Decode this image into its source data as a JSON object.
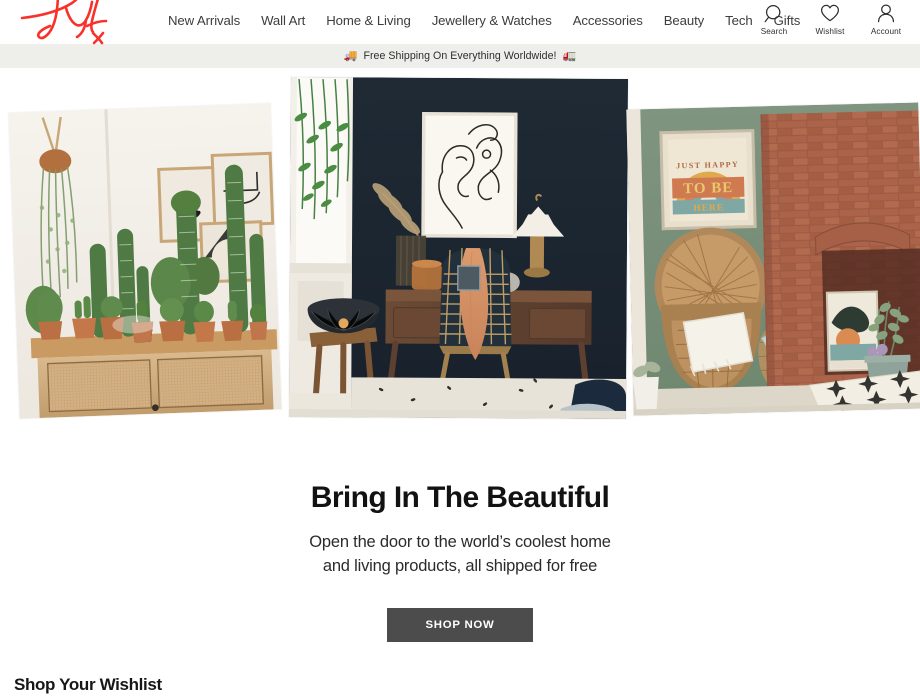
{
  "brand": {
    "logo_name": "fy-logo",
    "logo_color": "#f8312a"
  },
  "header": {
    "nav": [
      {
        "label": "New Arrivals",
        "name": "nav-new-arrivals"
      },
      {
        "label": "Wall Art",
        "name": "nav-wall-art"
      },
      {
        "label": "Home & Living",
        "name": "nav-home-living"
      },
      {
        "label": "Jewellery & Watches",
        "name": "nav-jewellery-watches"
      },
      {
        "label": "Accessories",
        "name": "nav-accessories"
      },
      {
        "label": "Beauty",
        "name": "nav-beauty"
      },
      {
        "label": "Tech",
        "name": "nav-tech"
      },
      {
        "label": "Gifts",
        "name": "nav-gifts"
      }
    ],
    "actions": [
      {
        "label": "Search",
        "icon": "search-icon"
      },
      {
        "label": "Wishlist",
        "icon": "heart-icon"
      },
      {
        "label": "Account",
        "icon": "person-icon"
      }
    ]
  },
  "announcement": {
    "left_icon": "truck-emoji",
    "text": "Free Shipping On Everything Worldwide!",
    "right_icon": "truck-emoji",
    "background": "#eeeeea"
  },
  "hero": {
    "images": [
      {
        "name": "hero-image-cactus-sideboard",
        "alt": "Cactus and succulent collection in terracotta pots on a rattan sideboard against a white wall with framed line-art prints"
      },
      {
        "name": "hero-image-navy-desk",
        "alt": "Dark navy wall with framed single-line face drawing above a mid-century wooden desk, rattan chair with terracotta throw, cone table lamp and pampas grass"
      },
      {
        "name": "hero-image-brick-fireplace",
        "alt": "Sage green wall with retro rainbow poster reading JUST HAPPY TO BE HERE, peacock rattan chair with cushions beside an exposed red brick fireplace and star-patterned rug"
      }
    ],
    "poster_text": "JUST HAPPY TO BE HERE",
    "title": "Bring In The Beautiful",
    "subtitle_line1": "Open the door to the world’s coolest home",
    "subtitle_line2": "and living products, all shipped for free",
    "cta_label": "SHOP NOW",
    "cta_color": "#4c4c4c"
  },
  "wishlist": {
    "title": "Shop Your Wishlist"
  }
}
